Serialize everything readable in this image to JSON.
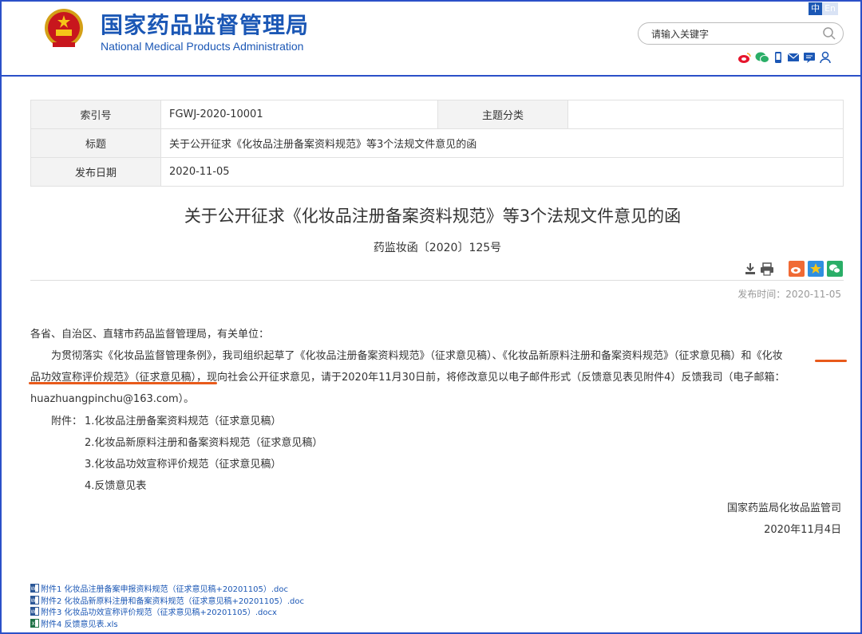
{
  "site": {
    "title_cn": "国家药品监督管理局",
    "title_en": "National Medical Products Administration",
    "lang_zh": "中",
    "lang_en": "En",
    "search_placeholder": "请输入关键字",
    "social_icons": [
      "weibo-icon",
      "wechat-icon",
      "mobile-icon",
      "mail-icon",
      "message-icon",
      "user-icon"
    ]
  },
  "meta": {
    "index_label": "索引号",
    "index_value": "FGWJ-2020-10001",
    "category_label": "主题分类",
    "category_value": "",
    "title_label": "标题",
    "title_value": "关于公开征求《化妆品注册备案资料规范》等3个法规文件意见的函",
    "date_label": "发布日期",
    "date_value": "2020-11-05"
  },
  "article": {
    "title": "关于公开征求《化妆品注册备案资料规范》等3个法规文件意见的函",
    "doc_number": "药监妆函〔2020〕125号",
    "publish_time": "发布时间：2020-11-05",
    "salutation": "各省、自治区、直辖市药品监督管理局，有关单位：",
    "para_line1": "为贯彻落实《化妆品监督管理条例》，我司组织起草了《化妆品注册备案资料规范》（征求意见稿）、《化妆品新原料注册和备案资料规范》（征求意见稿）和《化妆",
    "para_line2": "品功效宣称评价规范》（征求意见稿），现向社会公开征求意见，请于2020年11月30日前，将修改意见以电子邮件形式（反馈意见表见附件4）反馈我司（电子邮箱：",
    "para_line3": "huazhuangpinchu@163.com）。",
    "attachments_label": "附件：",
    "attachments": [
      "1.化妆品注册备案资料规范（征求意见稿）",
      "2.化妆品新原料注册和备案资料规范（征求意见稿）",
      "3.化妆品功效宣称评价规范（征求意见稿）",
      "4.反馈意见表"
    ],
    "signature_org": "国家药监局化妆品监管司",
    "signature_date": "2020年11月4日"
  },
  "files": [
    {
      "name": "附件1 化妆品注册备案申报资料规范（征求意见稿+20201105）.doc",
      "type": "word"
    },
    {
      "name": "附件2 化妆品新原料注册和备案资料规范（征求意见稿+20201105）.doc",
      "type": "word"
    },
    {
      "name": "附件3 化妆品功效宣称评价规范（征求意见稿+20201105）.docx",
      "type": "word"
    },
    {
      "name": "附件4 反馈意见表.xls",
      "type": "excel"
    }
  ],
  "colors": {
    "brand_blue": "#1b57b5",
    "frame_blue": "#2b50c8",
    "highlight_orange": "#e85a1b"
  }
}
